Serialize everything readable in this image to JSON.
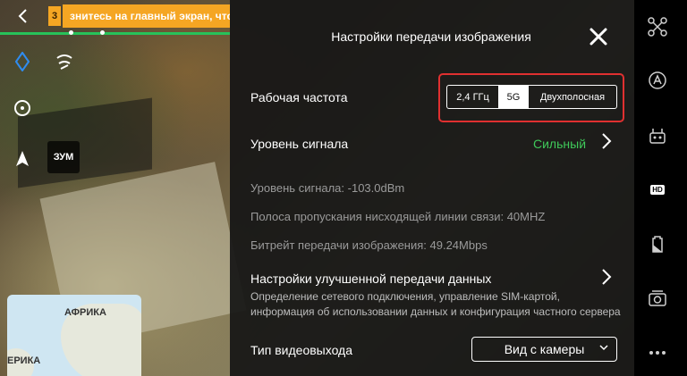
{
  "header": {
    "warning_count": "3",
    "warning_text": "знитесь на главный экран, чтоб"
  },
  "left": {
    "zoom_label": "ЗУМ"
  },
  "map": {
    "label_africa": "АФРИКА",
    "label_america": "ЕРИКА"
  },
  "panel": {
    "title": "Настройки передачи изображения",
    "working_freq_label": "Рабочая частота",
    "freq_options": [
      "2,4 ГГц",
      "5G",
      "Двухполосная"
    ],
    "freq_selected": "5G",
    "signal_level_label": "Уровень сигнала",
    "signal_level_value": "Сильный",
    "signal_strength": "Уровень сигнала: -103.0dBm",
    "downlink_bandwidth": "Полоса пропускания нисходящей линии связи: 40MHZ",
    "bitrate": "Битрейт передачи изображения: 49.24Mbps",
    "enhanced_title": "Настройки улучшенной передачи данных",
    "enhanced_desc_line1": "Определение сетевого подключения, управление SIM-картой,",
    "enhanced_desc_line2": "информация об использовании данных и конфигурация частного сервера",
    "video_output_label": "Тип видеовыхода",
    "video_output_value": "Вид с камеры"
  },
  "sidebar": {
    "hd_label": "HD",
    "icons": [
      "drone-icon",
      "autopilot-icon",
      "remote-controller-icon",
      "hd-transmission-icon",
      "battery-icon",
      "camera-icon",
      "more-icon"
    ]
  },
  "colors": {
    "warning": "#f5a623",
    "accent_green": "#3fc95a",
    "highlight_red": "#e03030"
  }
}
